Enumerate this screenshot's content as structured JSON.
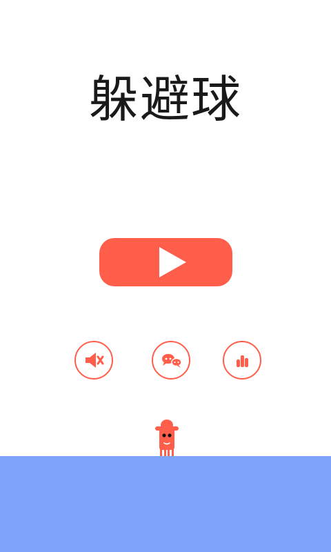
{
  "title": "躲避球",
  "colors": {
    "accent": "#ff5e4b",
    "ground": "#7fa3f9",
    "background": "#ffffff",
    "title_text": "#1a1a1a"
  },
  "buttons": {
    "play": {
      "icon": "play-icon"
    },
    "sound": {
      "icon": "speaker-muted-icon"
    },
    "share": {
      "icon": "chat-bubbles-icon"
    },
    "leaderboard": {
      "icon": "bar-chart-icon"
    }
  },
  "character": {
    "icon": "red-mascot-icon"
  }
}
